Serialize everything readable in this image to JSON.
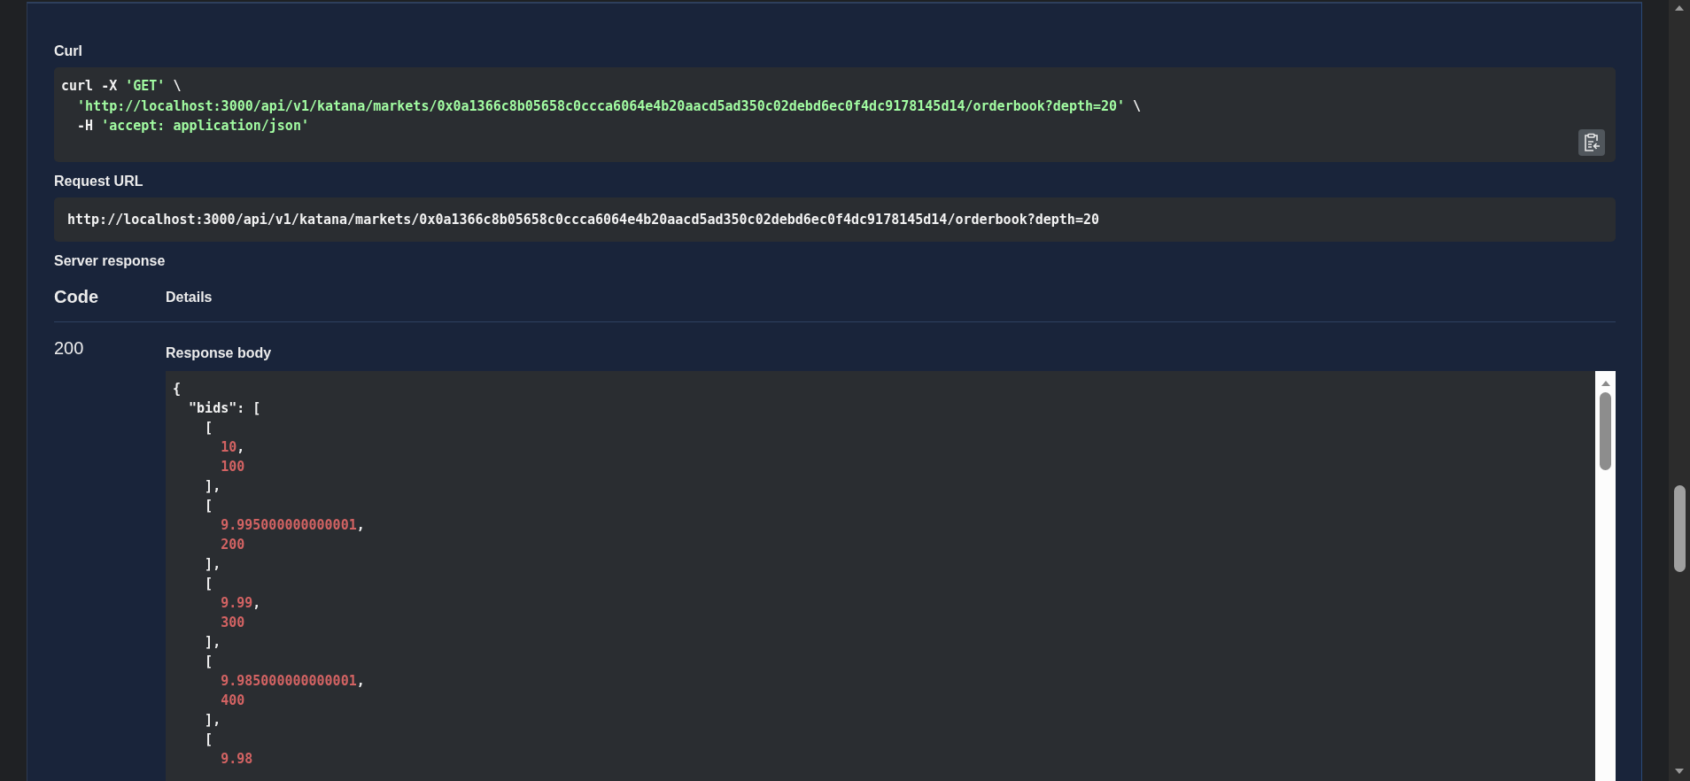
{
  "curl": {
    "label": "Curl",
    "lines": [
      [
        {
          "t": "curl -X ",
          "kind": "plain"
        },
        {
          "t": "'GET'",
          "kind": "string"
        },
        {
          "t": " \\",
          "kind": "plain"
        }
      ],
      [
        {
          "t": "  'http://localhost:3000/api/v1/katana/markets/0x0a1366c8b05658c0ccca6064e4b20aacd5ad350c02debd6ec0f4dc9178145d14/orderbook?depth=20'",
          "kind": "string"
        },
        {
          "t": " \\",
          "kind": "plain"
        }
      ],
      [
        {
          "t": "  -H ",
          "kind": "plain"
        },
        {
          "t": "'accept: application/json'",
          "kind": "string"
        }
      ]
    ]
  },
  "request_url": {
    "label": "Request URL",
    "value": "http://localhost:3000/api/v1/katana/markets/0x0a1366c8b05658c0ccca6064e4b20aacd5ad350c02debd6ec0f4dc9178145d14/orderbook?depth=20"
  },
  "server_response": {
    "label": "Server response",
    "columns": [
      "Code",
      "Details"
    ],
    "code": "200",
    "body_label": "Response body",
    "body_lines": [
      [
        {
          "t": "{",
          "kind": "punct"
        }
      ],
      [
        {
          "t": "  \"bids\"",
          "kind": "key"
        },
        {
          "t": ": [",
          "kind": "punct"
        }
      ],
      [
        {
          "t": "    [",
          "kind": "punct"
        }
      ],
      [
        {
          "t": "      10",
          "kind": "number"
        },
        {
          "t": ",",
          "kind": "punct"
        }
      ],
      [
        {
          "t": "      100",
          "kind": "number"
        }
      ],
      [
        {
          "t": "    ],",
          "kind": "punct"
        }
      ],
      [
        {
          "t": "    [",
          "kind": "punct"
        }
      ],
      [
        {
          "t": "      9.995000000000001",
          "kind": "number"
        },
        {
          "t": ",",
          "kind": "punct"
        }
      ],
      [
        {
          "t": "      200",
          "kind": "number"
        }
      ],
      [
        {
          "t": "    ],",
          "kind": "punct"
        }
      ],
      [
        {
          "t": "    [",
          "kind": "punct"
        }
      ],
      [
        {
          "t": "      9.99",
          "kind": "number"
        },
        {
          "t": ",",
          "kind": "punct"
        }
      ],
      [
        {
          "t": "      300",
          "kind": "number"
        }
      ],
      [
        {
          "t": "    ],",
          "kind": "punct"
        }
      ],
      [
        {
          "t": "    [",
          "kind": "punct"
        }
      ],
      [
        {
          "t": "      9.985000000000001",
          "kind": "number"
        },
        {
          "t": ",",
          "kind": "punct"
        }
      ],
      [
        {
          "t": "      400",
          "kind": "number"
        }
      ],
      [
        {
          "t": "    ],",
          "kind": "punct"
        }
      ],
      [
        {
          "t": "    [",
          "kind": "punct"
        }
      ],
      [
        {
          "t": "      9.98",
          "kind": "number"
        }
      ]
    ]
  }
}
